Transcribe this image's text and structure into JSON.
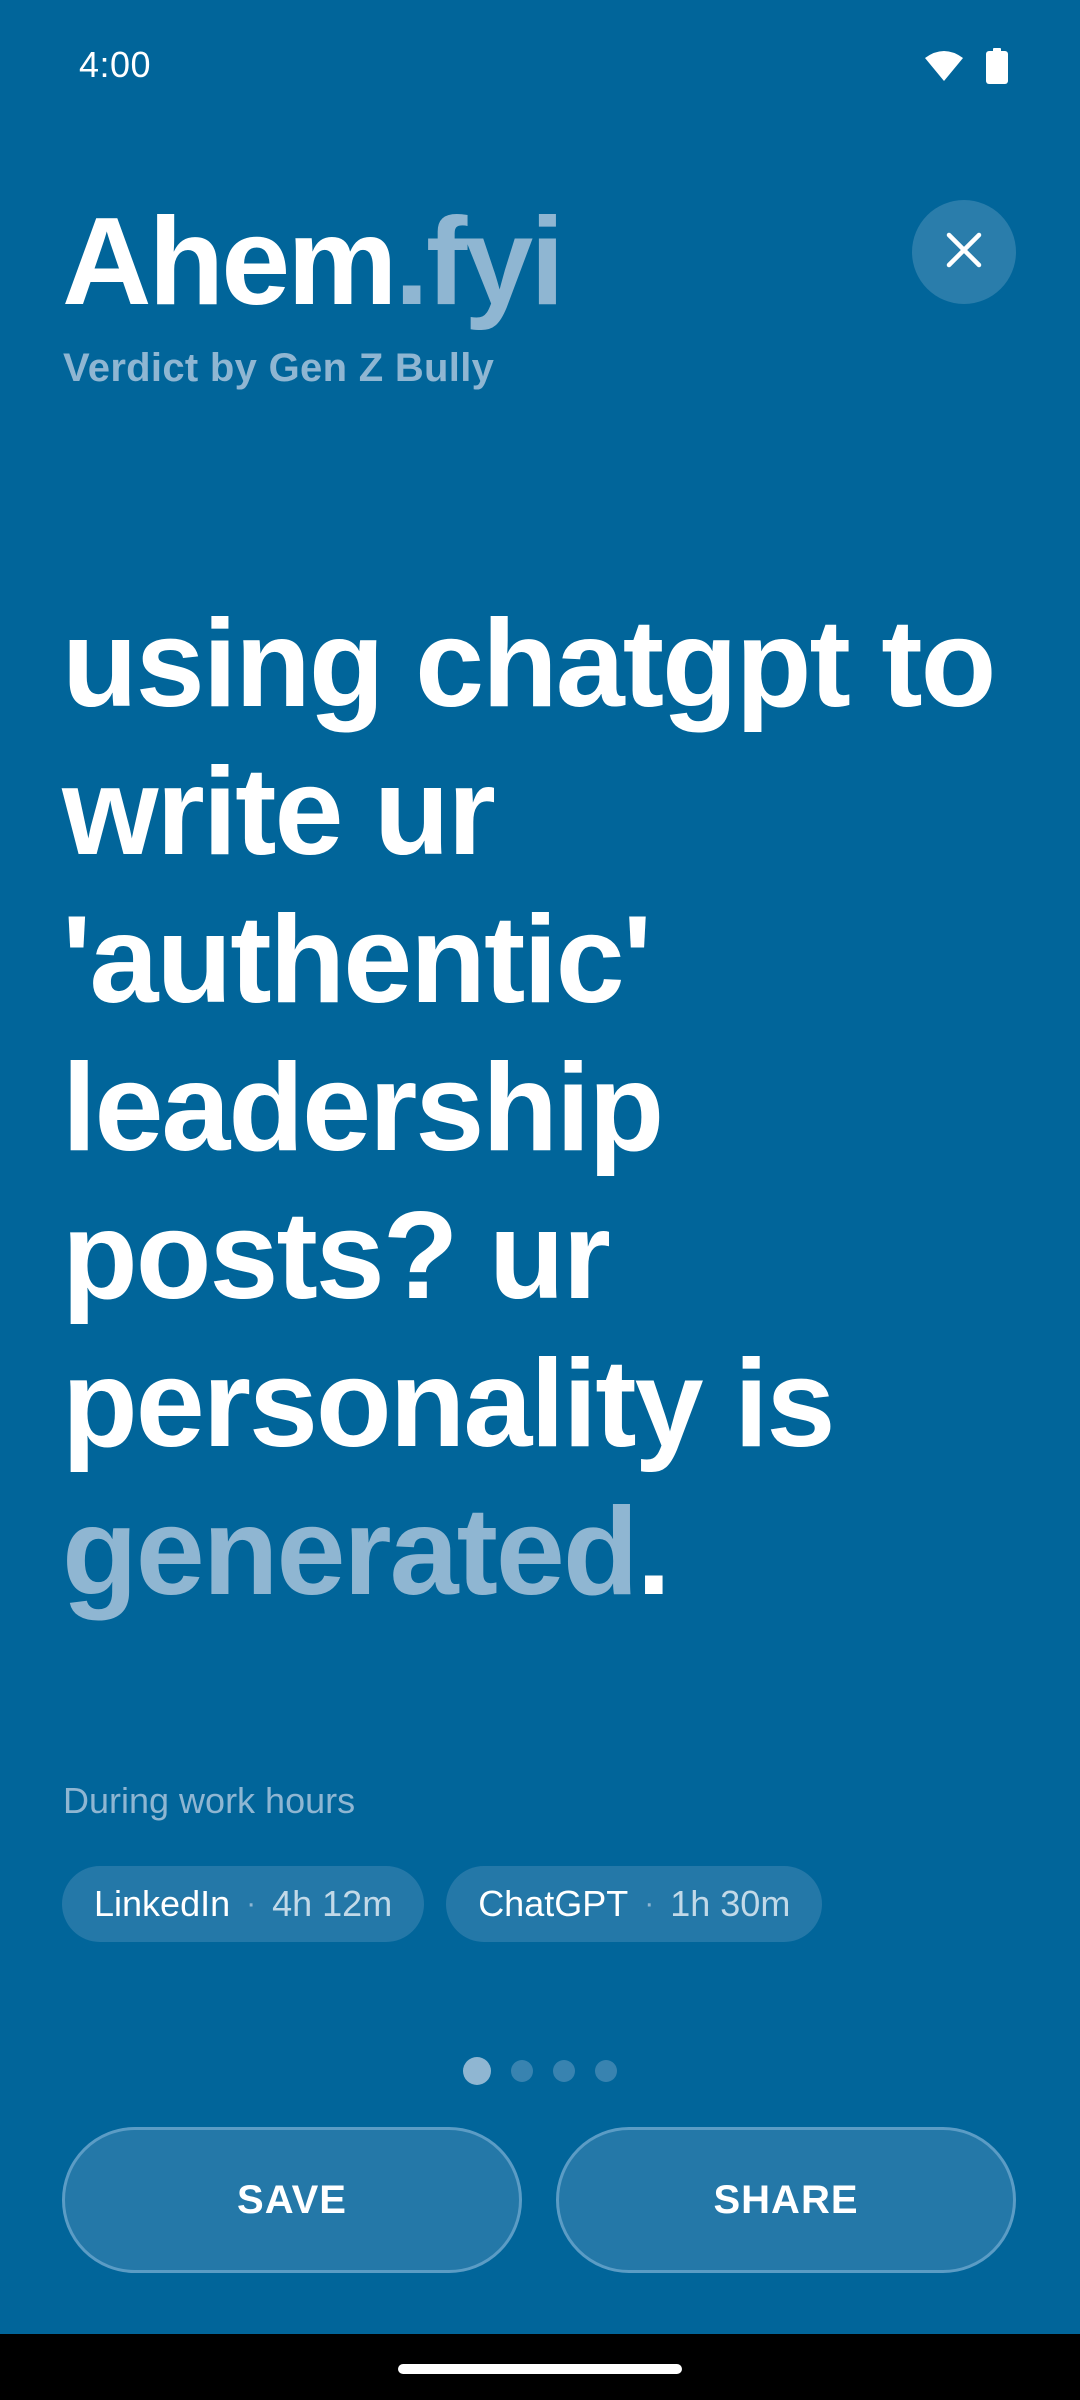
{
  "status_bar": {
    "time": "4:00",
    "icons": [
      "wifi-icon",
      "battery-icon"
    ]
  },
  "header": {
    "brand_main": "Ahem",
    "brand_accent": ".fyi",
    "subtitle": "Verdict by Gen Z Bully",
    "close_icon": "close-icon"
  },
  "verdict": {
    "text": "using chatgpt to write ur 'authentic' leadership posts? ur personality is ",
    "accent_word": "generated",
    "ending": "."
  },
  "usage": {
    "label": "During work hours",
    "chips": [
      {
        "app": "LinkedIn",
        "separator": "·",
        "time": "4h 12m"
      },
      {
        "app": "ChatGPT",
        "separator": "·",
        "time": "1h 30m"
      }
    ]
  },
  "pager": {
    "count": 4,
    "active_index": 0
  },
  "actions": {
    "save_label": "SAVE",
    "share_label": "SHARE"
  },
  "colors": {
    "background": "#01659A",
    "accent": "#8FB6D2",
    "chip_bg": "#2478A8"
  }
}
